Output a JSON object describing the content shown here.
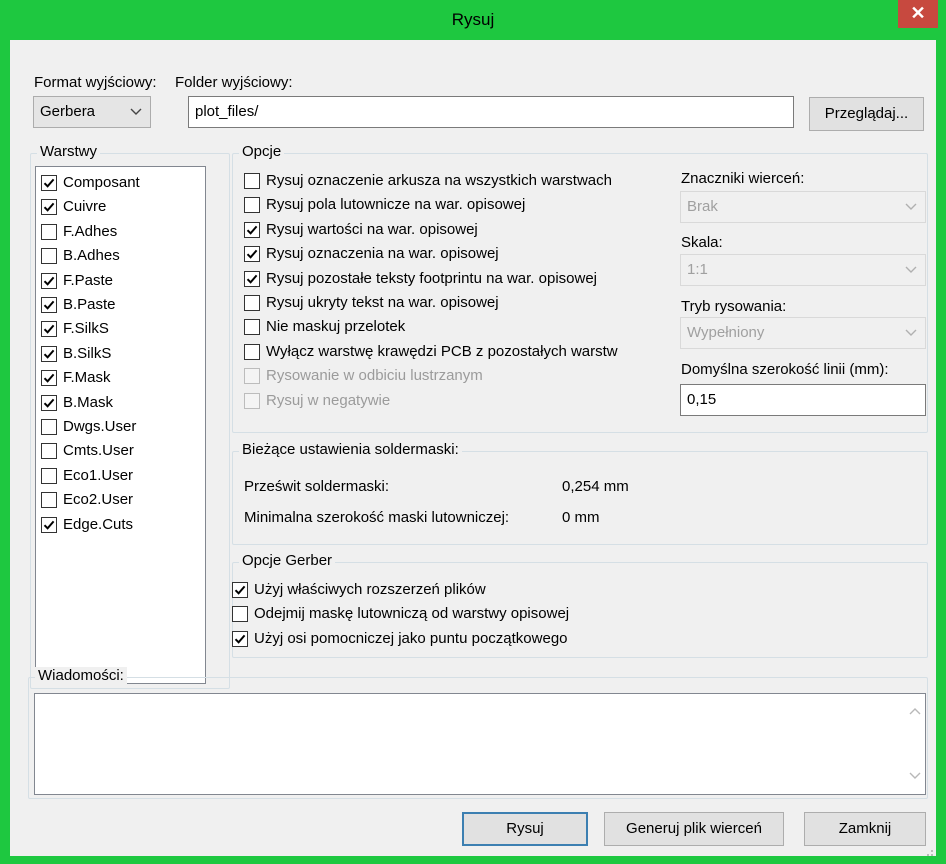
{
  "window": {
    "title": "Rysuj"
  },
  "format": {
    "label": "Format wyjściowy:",
    "value": "Gerbera"
  },
  "folder": {
    "label": "Folder wyjściowy:",
    "value": "plot_files/",
    "browse": "Przeglądaj..."
  },
  "layers": {
    "title": "Warstwy",
    "items": [
      {
        "label": "Composant",
        "checked": true
      },
      {
        "label": "Cuivre",
        "checked": true
      },
      {
        "label": "F.Adhes",
        "checked": false
      },
      {
        "label": "B.Adhes",
        "checked": false
      },
      {
        "label": "F.Paste",
        "checked": true
      },
      {
        "label": "B.Paste",
        "checked": true
      },
      {
        "label": "F.SilkS",
        "checked": true
      },
      {
        "label": "B.SilkS",
        "checked": true
      },
      {
        "label": "F.Mask",
        "checked": true
      },
      {
        "label": "B.Mask",
        "checked": true
      },
      {
        "label": "Dwgs.User",
        "checked": false
      },
      {
        "label": "Cmts.User",
        "checked": false
      },
      {
        "label": "Eco1.User",
        "checked": false
      },
      {
        "label": "Eco2.User",
        "checked": false
      },
      {
        "label": "Edge.Cuts",
        "checked": true
      }
    ]
  },
  "options": {
    "title": "Opcje",
    "items": [
      {
        "label": "Rysuj oznaczenie arkusza na wszystkich warstwach",
        "checked": false,
        "disabled": false
      },
      {
        "label": "Rysuj pola lutownicze na war. opisowej",
        "checked": false,
        "disabled": false
      },
      {
        "label": "Rysuj wartości na war. opisowej",
        "checked": true,
        "disabled": false
      },
      {
        "label": "Rysuj oznaczenia na war. opisowej",
        "checked": true,
        "disabled": false
      },
      {
        "label": "Rysuj pozostałe teksty footprintu na war. opisowej",
        "checked": true,
        "disabled": false
      },
      {
        "label": "Rysuj ukryty tekst na war. opisowej",
        "checked": false,
        "disabled": false
      },
      {
        "label": "Nie maskuj przelotek",
        "checked": false,
        "disabled": false
      },
      {
        "label": "Wyłącz warstwę krawędzi PCB z pozostałych warstw",
        "checked": false,
        "disabled": false
      },
      {
        "label": "Rysowanie w odbiciu lustrzanym",
        "checked": false,
        "disabled": true
      },
      {
        "label": "Rysuj w negatywie",
        "checked": false,
        "disabled": true
      }
    ],
    "drill_marks": {
      "label": "Znaczniki wierceń:",
      "value": "Brak"
    },
    "scale": {
      "label": "Skala:",
      "value": "1:1"
    },
    "plot_mode": {
      "label": "Tryb rysowania:",
      "value": "Wypełniony"
    },
    "line_width": {
      "label": "Domyślna szerokość linii (mm):",
      "value": "0,15"
    }
  },
  "soldermask": {
    "title": "Bieżące ustawienia soldermaski:",
    "clearance_label": "Prześwit soldermaski:",
    "clearance_value": "0,254 mm",
    "min_width_label": "Minimalna szerokość maski lutowniczej:",
    "min_width_value": "0 mm"
  },
  "gerber": {
    "title": "Opcje Gerber",
    "items": [
      {
        "label": "Użyj właściwych rozszerzeń plików",
        "checked": true
      },
      {
        "label": "Odejmij maskę lutowniczą od warstwy opisowej",
        "checked": false
      },
      {
        "label": "Użyj osi pomocniczej jako puntu początkowego",
        "checked": true
      }
    ]
  },
  "messages": {
    "title": "Wiadomości:"
  },
  "buttons": {
    "plot": "Rysuj",
    "drill": "Generuj plik wierceń",
    "close": "Zamknij"
  }
}
